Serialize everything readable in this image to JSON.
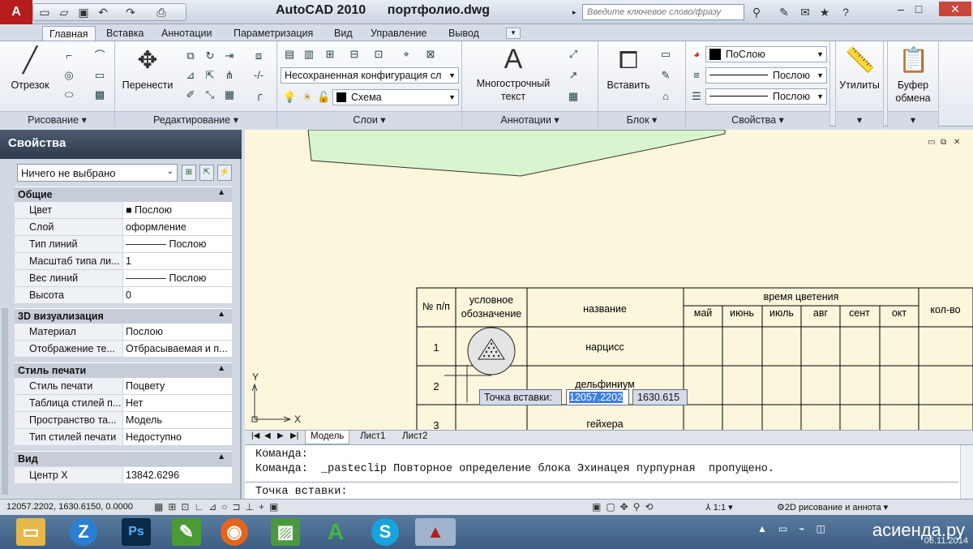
{
  "app": {
    "logo": "A",
    "title": "AutoCAD 2010      портфолио.dwg"
  },
  "search": {
    "placeholder": "Введите ключевое слово/фразу"
  },
  "tabs": [
    "Главная",
    "Вставка",
    "Аннотации",
    "Параметризация",
    "Вид",
    "Управление",
    "Вывод"
  ],
  "ribbon": {
    "draw": {
      "title": "Рисование",
      "line": "Отрезок"
    },
    "modify": {
      "title": "Редактирование",
      "move": "Перенести"
    },
    "layers": {
      "title": "Слои",
      "config": "Несохраненная конфигурация сл",
      "layer": "Схема"
    },
    "annotation": {
      "title": "Аннотации",
      "mtext_line1": "Многострочный",
      "mtext_line2": "текст"
    },
    "block": {
      "title": "Блок",
      "insert": "Вставить"
    },
    "properties": {
      "title": "Свойства",
      "color": "ПоСлою",
      "linetype": "Послою",
      "lineweight": "Послою"
    },
    "utilities": {
      "label": "Утилиты"
    },
    "clipboard": {
      "line1": "Буфер",
      "line2": "обмена"
    }
  },
  "palette": {
    "title": "Свойства",
    "selection": "Ничего не выбрано",
    "general": {
      "title": "Общие",
      "rows": [
        {
          "k": "Цвет",
          "v": "■ Послою"
        },
        {
          "k": "Слой",
          "v": "оформление"
        },
        {
          "k": "Тип линий",
          "v": "———— Послою"
        },
        {
          "k": "Масштаб типа ли...",
          "v": "1"
        },
        {
          "k": "Вес линий",
          "v": "———— Послою"
        },
        {
          "k": "Высота",
          "v": "0"
        }
      ]
    },
    "viz3d": {
      "title": "3D визуализация",
      "rows": [
        {
          "k": "Материал",
          "v": "Послою"
        },
        {
          "k": "Отображение те...",
          "v": "Отбрасываемая и п..."
        }
      ]
    },
    "print": {
      "title": "Стиль печати",
      "rows": [
        {
          "k": "Стиль печати",
          "v": "Поцвету"
        },
        {
          "k": "Таблица стилей п...",
          "v": "Нет"
        },
        {
          "k": "Пространство та...",
          "v": "Модель"
        },
        {
          "k": "Тип стилей печати",
          "v": "Недоступно"
        }
      ]
    },
    "view": {
      "title": "Вид",
      "rows": [
        {
          "k": "Центр X",
          "v": "13842.6296"
        }
      ]
    }
  },
  "drawing_table": {
    "headers": {
      "num": "№ п/п",
      "symbol1": "условное",
      "symbol2": "обозначение",
      "name": "название",
      "bloom": "время цветения",
      "qty": "кол-во"
    },
    "months": [
      "май",
      "июнь",
      "июль",
      "авг",
      "сент",
      "окт"
    ],
    "rows": [
      {
        "n": "1",
        "name": "нарцисс"
      },
      {
        "n": "2",
        "name": "дельфиниум"
      },
      {
        "n": "3",
        "name": "гейхера"
      }
    ]
  },
  "ucs": {
    "x": "X",
    "y": "Y"
  },
  "dyn_input": {
    "label": "Точка вставки:",
    "x": "12057.2202",
    "y": "1630.615"
  },
  "layout_tabs": [
    "Модель",
    "Лист1",
    "Лист2"
  ],
  "command": {
    "line1": "Команда:",
    "line2": "Команда:  _pasteclip Повторное определение блока Эхинацея пурпурная  пропущено.",
    "prompt": "Точка вставки:"
  },
  "status": {
    "coords": "12057.2202, 1630.6150, 0.0000",
    "scale": "1:1",
    "workspace": "2D рисование и аннота"
  },
  "tray": {
    "brand": "асиенда.ру",
    "date": "06.11.2014"
  },
  "colors": {
    "accent": "#b71c1c",
    "canvas": "#fcf6dc",
    "highlight": "#3d7fe0",
    "shape_fill": "#d9f5d0"
  }
}
